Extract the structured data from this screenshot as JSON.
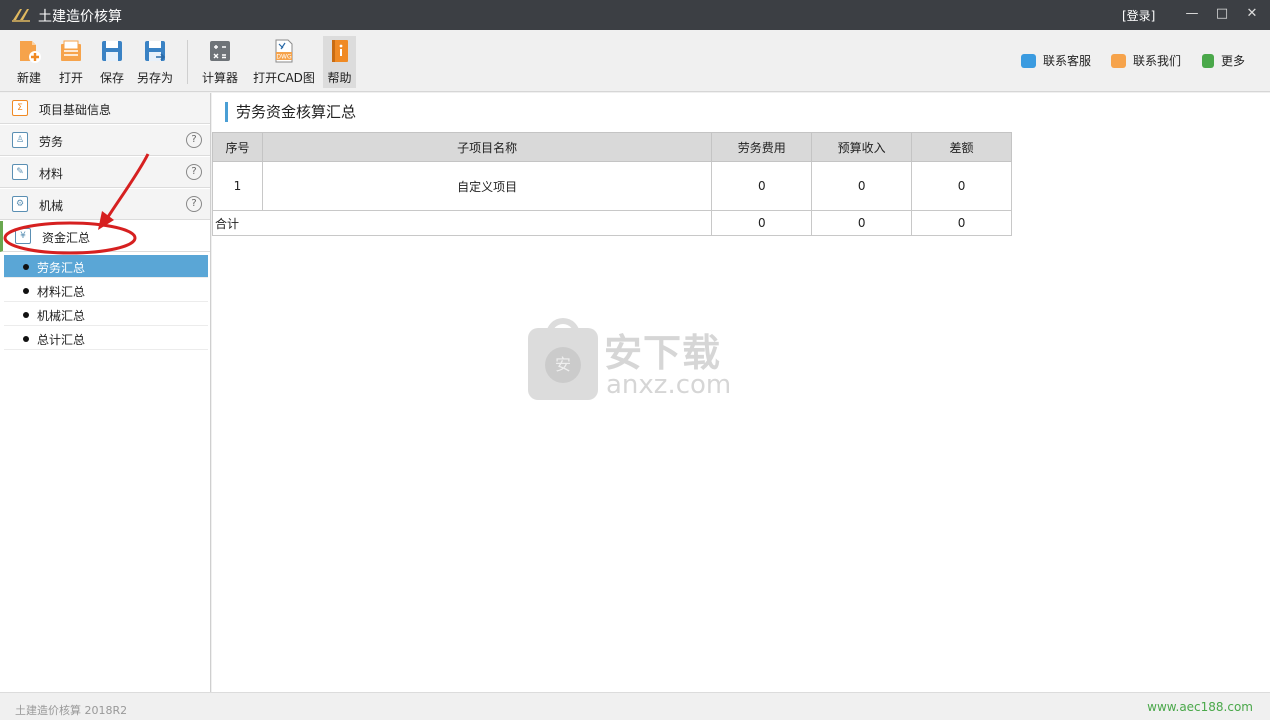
{
  "window": {
    "title": "土建造价核算",
    "login": "[登录]",
    "min_glyph": "—",
    "max_glyph": "□",
    "close_glyph": "✕"
  },
  "toolbar": {
    "new": "新建",
    "open": "打开",
    "save": "保存",
    "save_as": "另存为",
    "calculator": "计算器",
    "open_cad": "打开CAD图",
    "help": "帮助",
    "dwg_badge": "DWG",
    "contact_service": "联系客服",
    "contact_us": "联系我们",
    "more": "更多"
  },
  "sidebar": {
    "sections": [
      {
        "label": "项目基础信息",
        "icon": "sigma-icon",
        "glyph": "Σ"
      },
      {
        "label": "劳务",
        "icon": "person-icon",
        "glyph": "♙",
        "help": "?"
      },
      {
        "label": "材料",
        "icon": "brush-icon",
        "glyph": "✎",
        "help": "?"
      },
      {
        "label": "机械",
        "icon": "gear-icon",
        "glyph": "⚙",
        "help": "?"
      },
      {
        "label": "资金汇总",
        "icon": "money-icon",
        "glyph": "¥"
      }
    ],
    "subitems": [
      "劳务汇总",
      "材料汇总",
      "机械汇总",
      "总计汇总"
    ],
    "selected": 0
  },
  "main": {
    "title": "劳务资金核算汇总",
    "columns": [
      "序号",
      "子项目名称",
      "劳务费用",
      "预算收入",
      "差额"
    ],
    "rows": [
      [
        "1",
        "自定义项目",
        "0",
        "0",
        "0"
      ]
    ],
    "total": [
      "合计",
      "0",
      "0",
      "0"
    ]
  },
  "watermark": {
    "badge": "安",
    "cn": "安下载",
    "en": "anxz.com"
  },
  "status": {
    "left": "土建造价核算 2018R2",
    "right": "www.aec188.com"
  },
  "colors": {
    "titlebar": "#3c3f44",
    "selected_item": "#5aa6d6",
    "title_accent": "#4a9fd5",
    "status_link": "#4aa84a",
    "annotation": "#d62020"
  }
}
